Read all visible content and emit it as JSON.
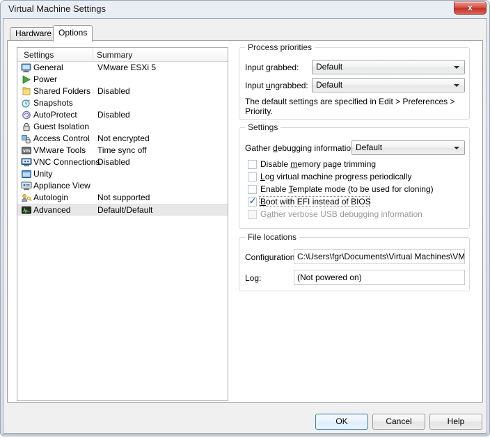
{
  "window": {
    "title": "Virtual Machine Settings",
    "close_label": "x"
  },
  "tabs": [
    {
      "label": "Hardware",
      "selected": false
    },
    {
      "label": "Options",
      "selected": true
    }
  ],
  "settings_list": {
    "columns": [
      "Settings",
      "Summary"
    ],
    "rows": [
      {
        "icon": "monitor-icon",
        "name": "General",
        "summary": "VMware ESXi 5"
      },
      {
        "icon": "play-green-icon",
        "name": "Power",
        "summary": ""
      },
      {
        "icon": "folder-yellow-icon",
        "name": "Shared Folders",
        "summary": "Disabled"
      },
      {
        "icon": "snapshot-clock-icon",
        "name": "Snapshots",
        "summary": ""
      },
      {
        "icon": "autoprotect-icon",
        "name": "AutoProtect",
        "summary": "Disabled"
      },
      {
        "icon": "lock-icon",
        "name": "Guest Isolation",
        "summary": ""
      },
      {
        "icon": "access-control-icon",
        "name": "Access Control",
        "summary": "Not encrypted"
      },
      {
        "icon": "vmware-tools-icon",
        "name": "VMware Tools",
        "summary": "Time sync off"
      },
      {
        "icon": "vnc-monitor-icon",
        "name": "VNC Connections",
        "summary": "Disabled"
      },
      {
        "icon": "unity-window-icon",
        "name": "Unity",
        "summary": ""
      },
      {
        "icon": "appliance-view-icon",
        "name": "Appliance View",
        "summary": ""
      },
      {
        "icon": "autologin-key-icon",
        "name": "Autologin",
        "summary": "Not supported"
      },
      {
        "icon": "advanced-chart-icon",
        "name": "Advanced",
        "summary": "Default/Default",
        "selected": true
      }
    ]
  },
  "process_priorities": {
    "title": "Process priorities",
    "input_grabbed": {
      "label_pre": "Input ",
      "label_acc": "g",
      "label_post": "rabbed:",
      "value": "Default"
    },
    "input_ungrabbed": {
      "label_pre": "Input ",
      "label_acc": "u",
      "label_post": "ngrabbed:",
      "value": "Default"
    },
    "note_line1": "The default settings are specified in Edit > Preferences >",
    "note_line2": "Priority."
  },
  "settings_group": {
    "title": "Settings",
    "gather_debugging": {
      "label_pre": "Gather ",
      "label_acc": "d",
      "label_post": "ebugging information:",
      "value": "Default"
    },
    "checkboxes": [
      {
        "pre": "Disable ",
        "acc": "m",
        "post": "emory page trimming",
        "full": "Disable memory page trimming",
        "checked": false,
        "disabled": false,
        "focused": false
      },
      {
        "pre": "",
        "acc": "L",
        "post": "og virtual machine progress periodically",
        "full": "Log virtual machine progress periodically",
        "checked": false,
        "disabled": false,
        "focused": false
      },
      {
        "pre": "Enable ",
        "acc": "T",
        "post": "emplate mode (to be used for cloning)",
        "full": "Enable Template mode (to be used for cloning)",
        "checked": false,
        "disabled": false,
        "focused": false
      },
      {
        "pre": "",
        "acc": "B",
        "post": "oot with EFI instead of BIOS",
        "full": "Boot with EFI instead of BIOS",
        "checked": true,
        "disabled": false,
        "focused": true
      },
      {
        "pre": "G",
        "acc": "a",
        "post": "ther verbose USB debugging information",
        "full": "Gather verbose USB debugging information",
        "checked": false,
        "disabled": true,
        "focused": false
      }
    ],
    "check_mark": "✓"
  },
  "file_locations": {
    "title": "File locations",
    "configuration_label": "Configuration:",
    "configuration_value": "C:\\Users\\fgr\\Documents\\Virtual Machines\\VMwar",
    "log_label": "Log:",
    "log_value": "(Not powered on)"
  },
  "buttons": {
    "ok": "OK",
    "cancel": "Cancel",
    "help": "Help"
  },
  "colors": {
    "accent_blue": "#3c7fb1",
    "close_red": "#c32f22",
    "check_blue": "#2c6fb8",
    "selection_grey": "#e8e8e8"
  }
}
